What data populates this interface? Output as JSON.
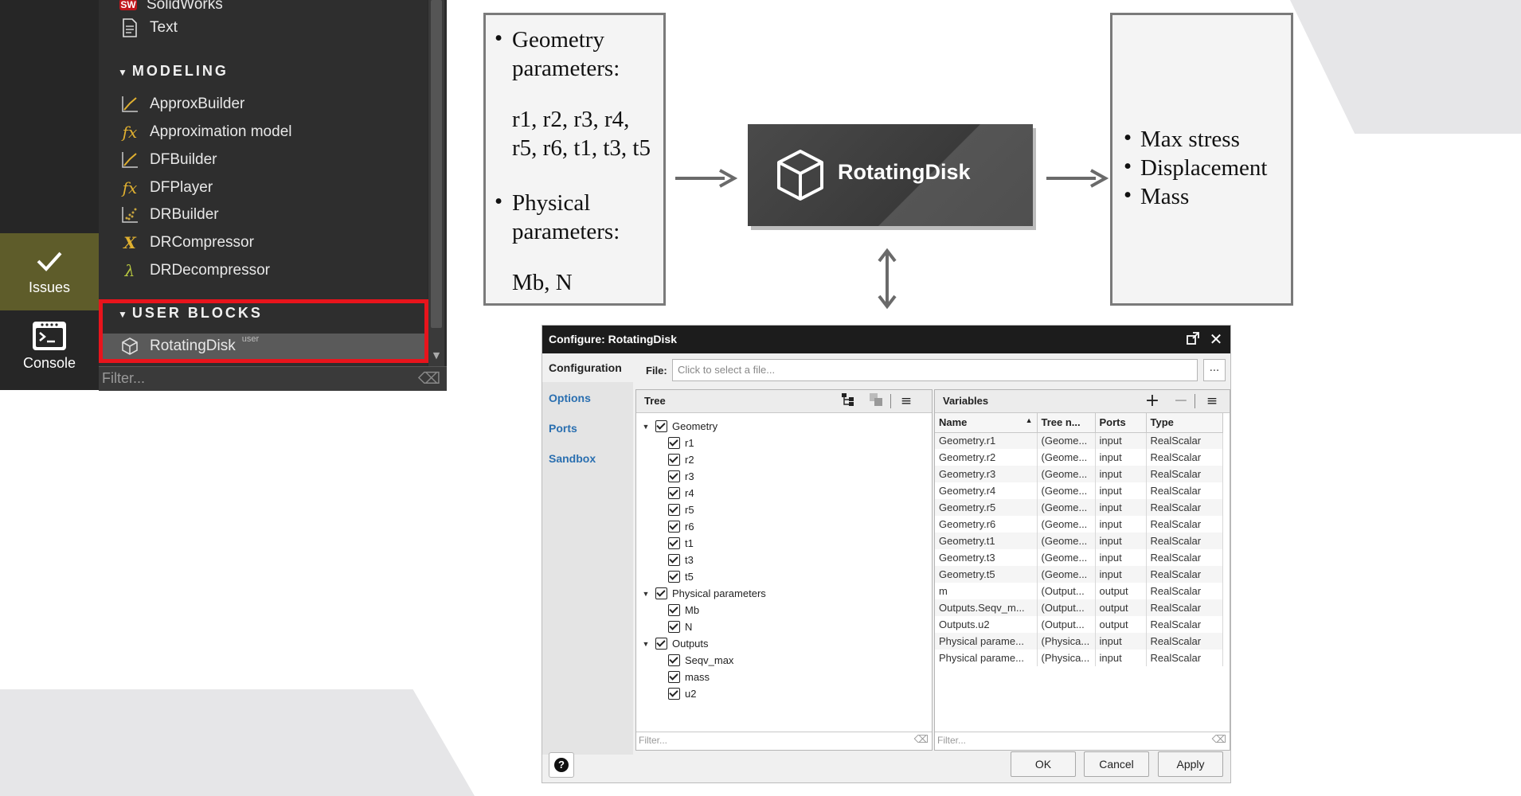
{
  "palette": {
    "top_item": "SolidWorks",
    "text_item": "Text",
    "modeling_header": "MODELING",
    "modeling_items": [
      "ApproxBuilder",
      "Approximation model",
      "DFBuilder",
      "DFPlayer",
      "DRBuilder",
      "DRCompressor",
      "DRDecompressor"
    ],
    "user_blocks_header": "USER BLOCKS",
    "user_block_item": "RotatingDisk",
    "user_tag": "user",
    "filter_placeholder": "Filter...",
    "issues_label": "Issues",
    "console_label": "Console"
  },
  "diagram": {
    "inputs": {
      "geometry_heading_1": "Geometry",
      "geometry_heading_2": "parameters:",
      "geometry_params_1": "r1, r2, r3, r4,",
      "geometry_params_2": "r5, r6, t1, t3, t5",
      "physical_heading_1": "Physical",
      "physical_heading_2": "parameters:",
      "physical_params": "Mb, N"
    },
    "block_title": "RotatingDisk",
    "outputs": [
      "Max stress",
      "Displacement",
      "Mass"
    ]
  },
  "dialog": {
    "title": "Configure: RotatingDisk",
    "nav": [
      "Configuration",
      "Options",
      "Ports",
      "Sandbox"
    ],
    "file_label": "File:",
    "file_placeholder": "Click to select a file...",
    "browse_label": "...",
    "tree_title": "Tree",
    "tree": [
      {
        "label": "Geometry",
        "level": 0,
        "expandable": true
      },
      {
        "label": "r1",
        "level": 1
      },
      {
        "label": "r2",
        "level": 1
      },
      {
        "label": "r3",
        "level": 1
      },
      {
        "label": "r4",
        "level": 1
      },
      {
        "label": "r5",
        "level": 1
      },
      {
        "label": "r6",
        "level": 1
      },
      {
        "label": "t1",
        "level": 1
      },
      {
        "label": "t3",
        "level": 1
      },
      {
        "label": "t5",
        "level": 1
      },
      {
        "label": "Physical parameters",
        "level": 0,
        "expandable": true
      },
      {
        "label": "Mb",
        "level": 1
      },
      {
        "label": "N",
        "level": 1
      },
      {
        "label": "Outputs",
        "level": 0,
        "expandable": true
      },
      {
        "label": "Seqv_max",
        "level": 1
      },
      {
        "label": "mass",
        "level": 1
      },
      {
        "label": "u2",
        "level": 1
      }
    ],
    "vars_title": "Variables",
    "columns": [
      "Name",
      "Tree n...",
      "Ports",
      "Type"
    ],
    "rows": [
      [
        "Geometry.r1",
        "(Geome...",
        "input",
        "RealScalar"
      ],
      [
        "Geometry.r2",
        "(Geome...",
        "input",
        "RealScalar"
      ],
      [
        "Geometry.r3",
        "(Geome...",
        "input",
        "RealScalar"
      ],
      [
        "Geometry.r4",
        "(Geome...",
        "input",
        "RealScalar"
      ],
      [
        "Geometry.r5",
        "(Geome...",
        "input",
        "RealScalar"
      ],
      [
        "Geometry.r6",
        "(Geome...",
        "input",
        "RealScalar"
      ],
      [
        "Geometry.t1",
        "(Geome...",
        "input",
        "RealScalar"
      ],
      [
        "Geometry.t3",
        "(Geome...",
        "input",
        "RealScalar"
      ],
      [
        "Geometry.t5",
        "(Geome...",
        "input",
        "RealScalar"
      ],
      [
        "m",
        "(Output...",
        "output",
        "RealScalar"
      ],
      [
        "Outputs.Seqv_m...",
        "(Output...",
        "output",
        "RealScalar"
      ],
      [
        "Outputs.u2",
        "(Output...",
        "output",
        "RealScalar"
      ],
      [
        "Physical parame...",
        "(Physica...",
        "input",
        "RealScalar"
      ],
      [
        "Physical parame...",
        "(Physica...",
        "input",
        "RealScalar"
      ]
    ],
    "filter_placeholder": "Filter...",
    "ok": "OK",
    "cancel": "Cancel",
    "apply": "Apply",
    "help": "?"
  },
  "colors": {
    "highlight": "#e8141c",
    "link": "#2a6fb0",
    "issues_bg": "#5e5c2a"
  }
}
